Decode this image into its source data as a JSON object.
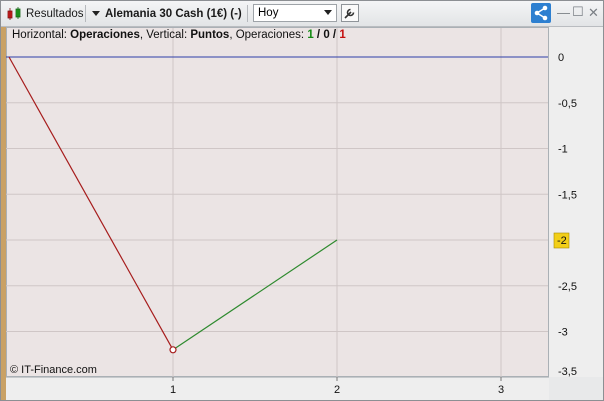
{
  "toolbar": {
    "results_label": "Resultados",
    "instrument_label": "Alemania 30 Cash (1€) (-)",
    "period_value": "Hoy",
    "window_controls": {
      "minimize": "—",
      "restore": "☐",
      "close": "✕"
    }
  },
  "legend": {
    "prefix_horizontal": "Horizontal: ",
    "horizontal_value": "Operaciones",
    "prefix_vertical": ", Vertical: ",
    "vertical_value": "Puntos",
    "prefix_ops": ", Operaciones: ",
    "ops_win": "1",
    "ops_sep1": " / ",
    "ops_neutral": "0",
    "ops_sep2": " / ",
    "ops_loss": "1"
  },
  "copyright": "© IT-Finance.com",
  "colors": {
    "zero_line": "#2e3ea8",
    "loss_segment": "#a61c1c",
    "gain_segment": "#2e8a2e",
    "last_value_badge": "#f2cf18"
  },
  "chart_data": {
    "type": "line",
    "x": [
      0,
      1,
      2
    ],
    "y": [
      0,
      -3.2,
      -2
    ],
    "xlabel": "",
    "ylabel": "",
    "xlim": [
      0,
      3.3
    ],
    "ylim": [
      -3.5,
      0.15
    ],
    "x_ticks": [
      "1",
      "2",
      "3"
    ],
    "x_tick_values": [
      1,
      2,
      3
    ],
    "y_ticks": [
      "0",
      "-0,5",
      "-1",
      "-1,5",
      "-2",
      "-2,5",
      "-3",
      "-3,5"
    ],
    "y_tick_values": [
      0,
      -0.5,
      -1,
      -1.5,
      -2,
      -2.5,
      -3,
      -3.5
    ],
    "last_value_label": "-2",
    "grid": true
  }
}
